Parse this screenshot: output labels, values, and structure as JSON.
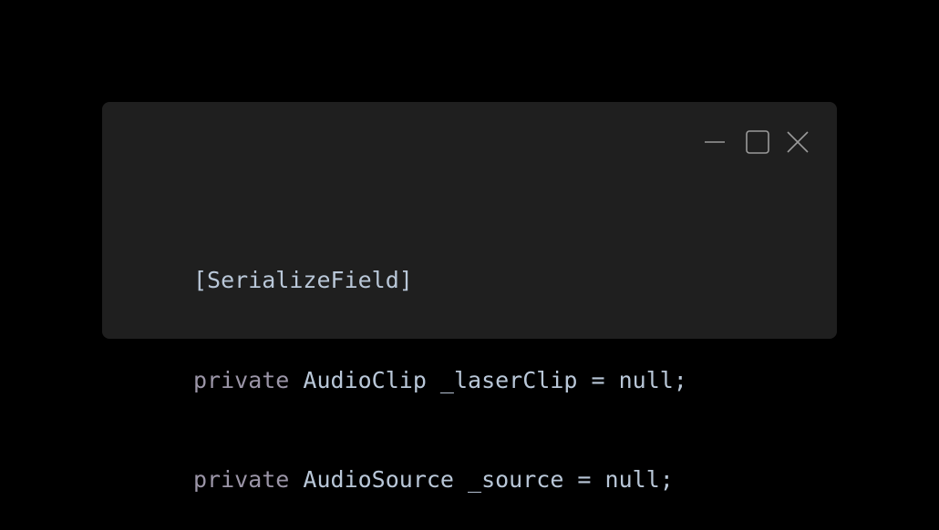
{
  "window": {
    "controls": {
      "minimize_icon": "minimize-icon",
      "maximize_icon": "maximize-icon",
      "close_icon": "close-icon"
    },
    "colors": {
      "page_background": "#000000",
      "window_background": "#1f1f1f",
      "text": "#b9c7d8",
      "keyword": "#9b95a7",
      "icon": "#9a9a9a"
    }
  },
  "code": {
    "lines": [
      {
        "text": "[SerializeField]"
      },
      {
        "keyword": "private",
        "rest": " AudioClip _laserClip = null;"
      },
      {
        "keyword": "private",
        "rest": " AudioSource _source = null;"
      }
    ]
  }
}
